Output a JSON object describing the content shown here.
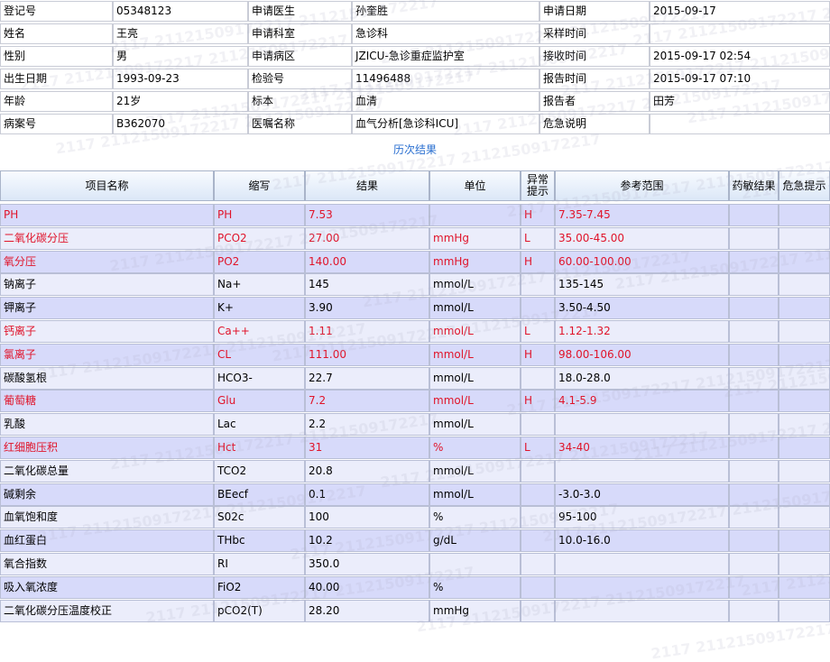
{
  "info": [
    [
      {
        "label": "登记号",
        "value": "05348123"
      },
      {
        "label": "申请医生",
        "value": "孙奎胜"
      },
      {
        "label": "申请日期",
        "value": "2015-09-17"
      }
    ],
    [
      {
        "label": "姓名",
        "value": "王亮"
      },
      {
        "label": "申请科室",
        "value": "急诊科"
      },
      {
        "label": "采样时间",
        "value": ""
      }
    ],
    [
      {
        "label": "性别",
        "value": "男"
      },
      {
        "label": "申请病区",
        "value": "JZICU-急诊重症监护室"
      },
      {
        "label": "接收时间",
        "value": "2015-09-17 02:54"
      }
    ],
    [
      {
        "label": "出生日期",
        "value": "1993-09-23"
      },
      {
        "label": "检验号",
        "value": "11496488"
      },
      {
        "label": "报告时间",
        "value": "2015-09-17 07:10"
      }
    ],
    [
      {
        "label": "年龄",
        "value": "21岁"
      },
      {
        "label": "标本",
        "value": "血清"
      },
      {
        "label": "报告者",
        "value": "田芳"
      }
    ],
    [
      {
        "label": "病案号",
        "value": "B362070"
      },
      {
        "label": "医嘱名称",
        "value": "血气分析[急诊科ICU]"
      },
      {
        "label": "危急说明",
        "value": ""
      }
    ]
  ],
  "history_link": "历次结果",
  "columns": {
    "name": "项目名称",
    "abbr": "缩写",
    "result": "结果",
    "unit": "单位",
    "flag_line1": "异常",
    "flag_line2": "提示",
    "range": "参考范围",
    "drug": "药敏结果",
    "critical": "危急提示"
  },
  "rows": [
    {
      "name": "PH",
      "abbr": "PH",
      "result": "7.53",
      "unit": "",
      "flag": "H",
      "range": "7.35-7.45",
      "abnormal": true
    },
    {
      "name": "二氧化碳分压",
      "abbr": "PCO2",
      "result": "27.00",
      "unit": "mmHg",
      "flag": "L",
      "range": "35.00-45.00",
      "abnormal": true
    },
    {
      "name": "氧分压",
      "abbr": "PO2",
      "result": "140.00",
      "unit": "mmHg",
      "flag": "H",
      "range": "60.00-100.00",
      "abnormal": true
    },
    {
      "name": "钠离子",
      "abbr": "Na+",
      "result": "145",
      "unit": "mmol/L",
      "flag": "",
      "range": "135-145",
      "abnormal": false
    },
    {
      "name": "钾离子",
      "abbr": "K+",
      "result": "3.90",
      "unit": "mmol/L",
      "flag": "",
      "range": "3.50-4.50",
      "abnormal": false
    },
    {
      "name": "钙离子",
      "abbr": "Ca++",
      "result": "1.11",
      "unit": "mmol/L",
      "flag": "L",
      "range": "1.12-1.32",
      "abnormal": true
    },
    {
      "name": "氯离子",
      "abbr": "CL",
      "result": "111.00",
      "unit": "mmol/L",
      "flag": "H",
      "range": "98.00-106.00",
      "abnormal": true
    },
    {
      "name": "碳酸氢根",
      "abbr": "HCO3-",
      "result": "22.7",
      "unit": "mmol/L",
      "flag": "",
      "range": "18.0-28.0",
      "abnormal": false
    },
    {
      "name": "葡萄糖",
      "abbr": "Glu",
      "result": "7.2",
      "unit": "mmol/L",
      "flag": "H",
      "range": "4.1-5.9",
      "abnormal": true
    },
    {
      "name": "乳酸",
      "abbr": "Lac",
      "result": "2.2",
      "unit": "mmol/L",
      "flag": "",
      "range": "",
      "abnormal": false
    },
    {
      "name": "红细胞压积",
      "abbr": "Hct",
      "result": "31",
      "unit": "%",
      "flag": "L",
      "range": "34-40",
      "abnormal": true
    },
    {
      "name": "二氧化碳总量",
      "abbr": "TCO2",
      "result": "20.8",
      "unit": "mmol/L",
      "flag": "",
      "range": "",
      "abnormal": false
    },
    {
      "name": "碱剩余",
      "abbr": "BEecf",
      "result": "0.1",
      "unit": "mmol/L",
      "flag": "",
      "range": "-3.0-3.0",
      "abnormal": false
    },
    {
      "name": "血氧饱和度",
      "abbr": "S02c",
      "result": "100",
      "unit": "%",
      "flag": "",
      "range": "95-100",
      "abnormal": false
    },
    {
      "name": "血红蛋白",
      "abbr": "THbc",
      "result": "10.2",
      "unit": "g/dL",
      "flag": "",
      "range": "10.0-16.0",
      "abnormal": false
    },
    {
      "name": "氧合指数",
      "abbr": "RI",
      "result": "350.0",
      "unit": "",
      "flag": "",
      "range": "",
      "abnormal": false
    },
    {
      "name": "吸入氧浓度",
      "abbr": "FiO2",
      "result": "40.00",
      "unit": "%",
      "flag": "",
      "range": "",
      "abnormal": false
    },
    {
      "name": "二氧化碳分压温度校正",
      "abbr": "pCO2(T)",
      "result": "28.20",
      "unit": "mmHg",
      "flag": "",
      "range": "",
      "abnormal": false
    }
  ],
  "watermark": "2117 21121509172217 21121509172217"
}
